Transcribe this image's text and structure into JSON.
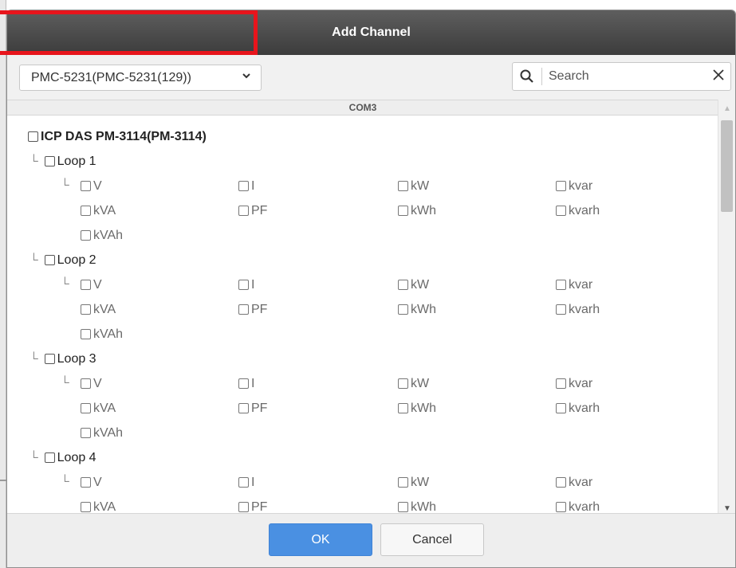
{
  "dialog": {
    "title": "Add Channel",
    "device_select": "PMC-5231(PMC-5231(129))",
    "search_placeholder": "Search",
    "section": "COM3",
    "device_name": "ICP DAS PM-3114(PM-3114)",
    "loops": [
      {
        "label": "Loop 1",
        "measurements": [
          "V",
          "I",
          "kW",
          "kvar",
          "kVA",
          "PF",
          "kWh",
          "kvarh",
          "kVAh"
        ]
      },
      {
        "label": "Loop 2",
        "measurements": [
          "V",
          "I",
          "kW",
          "kvar",
          "kVA",
          "PF",
          "kWh",
          "kvarh",
          "kVAh"
        ]
      },
      {
        "label": "Loop 3",
        "measurements": [
          "V",
          "I",
          "kW",
          "kvar",
          "kVA",
          "PF",
          "kWh",
          "kvarh",
          "kVAh"
        ]
      },
      {
        "label": "Loop 4",
        "measurements": [
          "V",
          "I",
          "kW",
          "kvar",
          "kVA",
          "PF",
          "kWh",
          "kvarh"
        ]
      }
    ],
    "ok_label": "OK",
    "cancel_label": "Cancel"
  },
  "colors": {
    "highlight": "#e8151c",
    "ok_button": "#4a90e2",
    "titlebar": "#4a4a4a"
  },
  "icons": {
    "search": "search-icon",
    "clear": "close-icon",
    "dropdown": "chevron-down-icon"
  }
}
